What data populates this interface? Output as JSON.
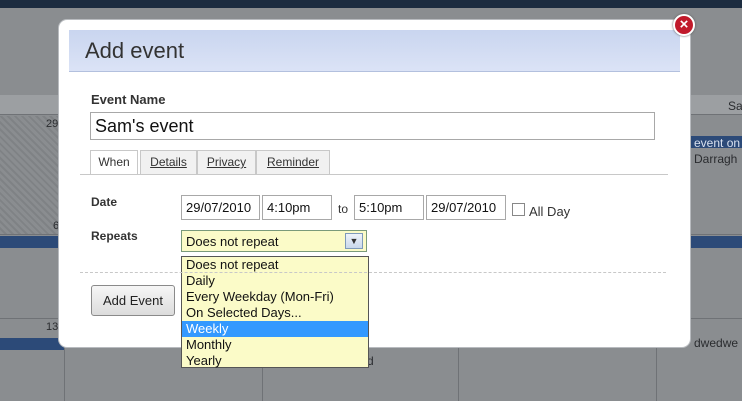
{
  "background": {
    "header_right": "Sa",
    "daynums": [
      "29",
      "6",
      "13"
    ],
    "event1_line1": "event on",
    "event1_line2": "Darragh",
    "event2": "dwedwe",
    "partial_text": "d"
  },
  "modal": {
    "title": "Add event",
    "close_glyph": "×"
  },
  "form": {
    "event_name_label": "Event Name",
    "event_name_value": "Sam's event",
    "tabs": [
      "When",
      "Details",
      "Privacy",
      "Reminder"
    ],
    "date_label": "Date",
    "start_date": "29/07/2010",
    "start_time": "4:10pm",
    "to_label": "to",
    "end_time": "5:10pm",
    "end_date": "29/07/2010",
    "all_day_label": "All Day",
    "repeats_label": "Repeats",
    "repeats_selected": "Does not repeat",
    "repeats_options": [
      "Does not repeat",
      "Daily",
      "Every Weekday (Mon-Fri)",
      "On Selected Days...",
      "Weekly",
      "Monthly",
      "Yearly"
    ],
    "highlighted_option": "Weekly",
    "add_button": "Add Event"
  },
  "colors": {
    "header_gradient": "#c9d5ef",
    "close_red": "#c11a2b",
    "select_bg": "#fbfbc8",
    "highlight": "#3399ff"
  }
}
